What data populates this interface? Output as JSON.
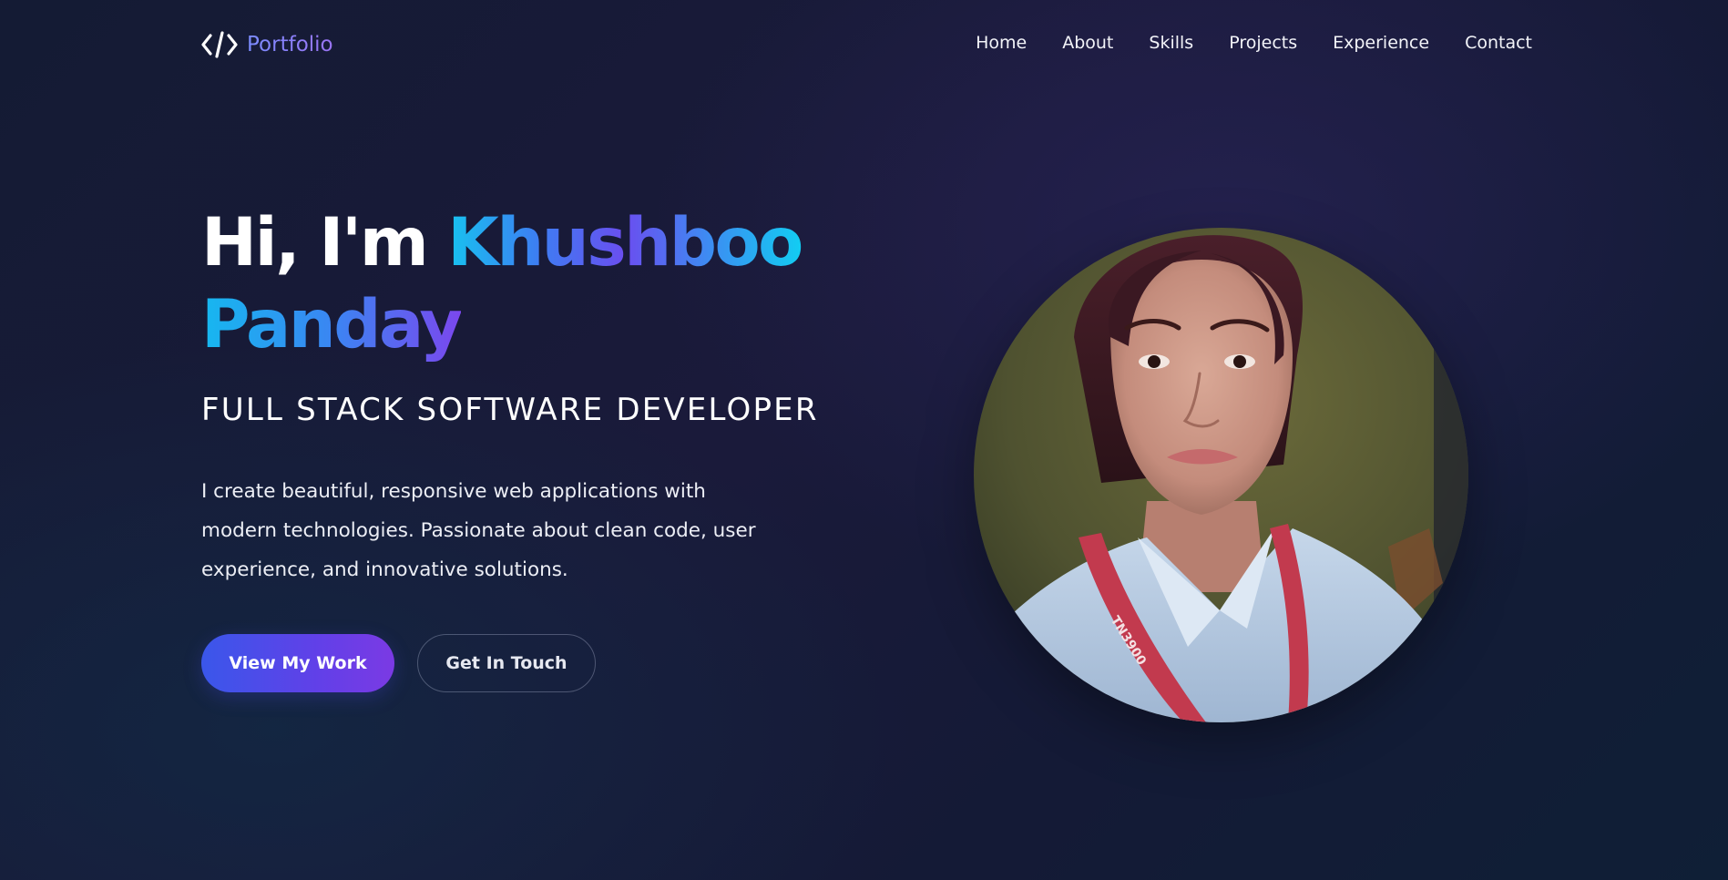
{
  "brand": {
    "icon": "code-brackets-icon",
    "label": "Portfolio"
  },
  "nav": {
    "items": [
      {
        "label": "Home"
      },
      {
        "label": "About"
      },
      {
        "label": "Skills"
      },
      {
        "label": "Projects"
      },
      {
        "label": "Experience"
      },
      {
        "label": "Contact"
      }
    ]
  },
  "hero": {
    "greeting": "Hi, I'm ",
    "name_first": "Khushboo",
    "name_last": "Panday",
    "subtitle": "FULL STACK SOFTWARE DEVELOPER",
    "description": "I create beautiful, responsive web applications with modern technologies. Passionate about clean code, user experience, and innovative solutions.",
    "primary_button": "View My Work",
    "secondary_button": "Get In Touch",
    "photo_badge_text": "TN3900"
  },
  "colors": {
    "background": "#161b38",
    "accent_cyan": "#12cdf2",
    "accent_blue": "#3a57ea",
    "accent_purple": "#7b3ae4",
    "brand_text": "#8a80f8"
  }
}
